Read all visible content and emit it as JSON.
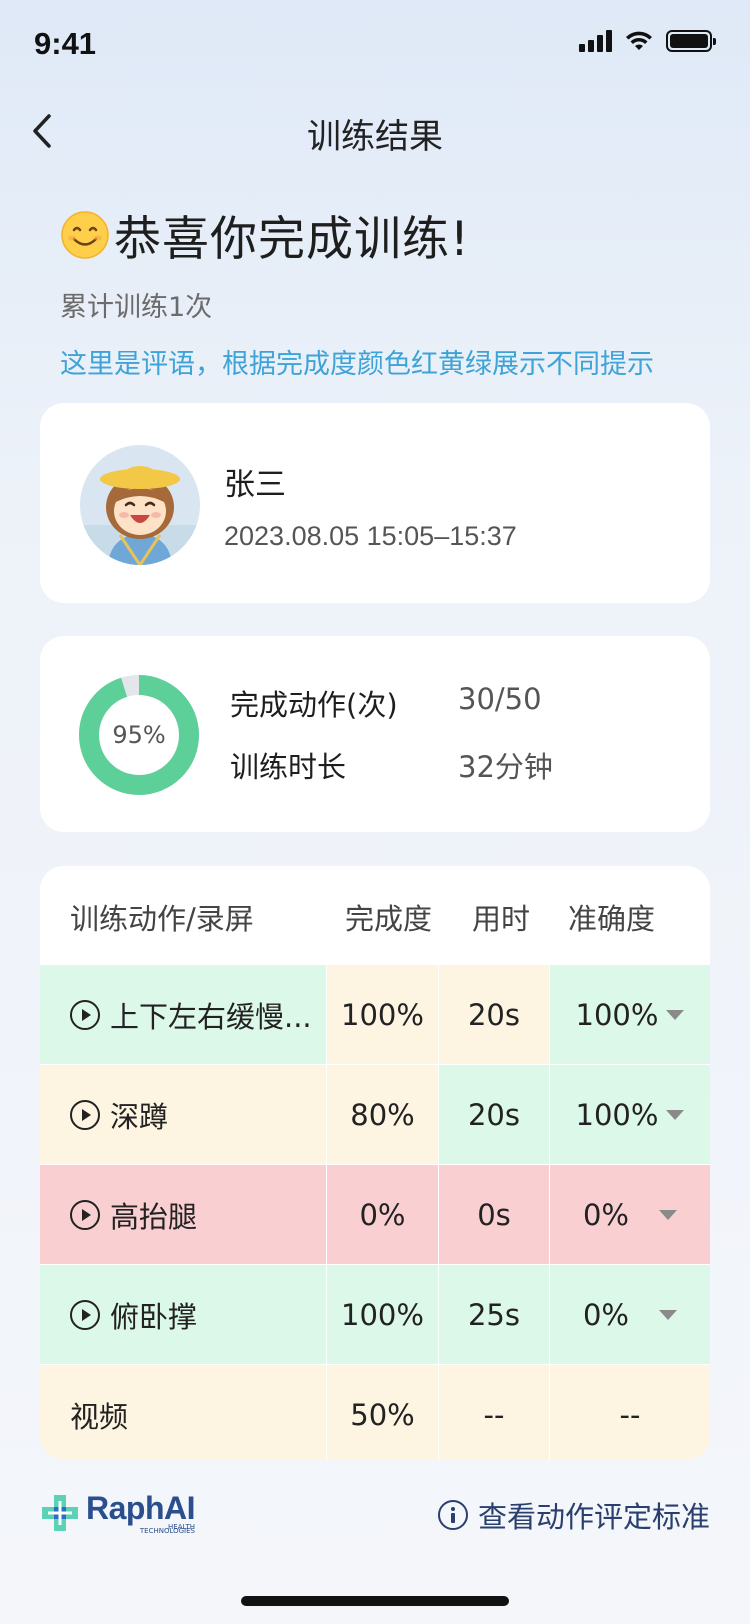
{
  "status_bar": {
    "time": "9:41"
  },
  "nav": {
    "title": "训练结果"
  },
  "header": {
    "congrats": "恭喜你完成训练!",
    "cumulative": "累计训练1次",
    "comment": "这里是评语，根据完成度颜色红黄绿展示不同提示"
  },
  "profile": {
    "name": "张三",
    "datetime": "2023.08.05 15:05–15:37"
  },
  "stats": {
    "completion_percent_label": "95%",
    "completion_fraction": 0.95,
    "actions_label": "完成动作(次)",
    "actions_value": "30/50",
    "duration_label": "训练时长",
    "duration_value": "32分钟"
  },
  "table": {
    "headers": [
      "训练动作/录屏",
      "完成度",
      "用时",
      "准确度"
    ],
    "rows": [
      {
        "name": "上下左右缓慢...",
        "completion": "100%",
        "time": "20s",
        "accuracy": "100%",
        "has_play": true,
        "has_caret": true
      },
      {
        "name": "深蹲",
        "completion": "80%",
        "time": "20s",
        "accuracy": "100%",
        "has_play": true,
        "has_caret": true
      },
      {
        "name": "高抬腿",
        "completion": "0%",
        "time": "0s",
        "accuracy": "0%",
        "has_play": true,
        "has_caret": true
      },
      {
        "name": "俯卧撑",
        "completion": "100%",
        "time": "25s",
        "accuracy": "0%",
        "has_play": true,
        "has_caret": true
      },
      {
        "name": "视频",
        "completion": "50%",
        "time": "--",
        "accuracy": "--",
        "has_play": false,
        "has_caret": false
      }
    ]
  },
  "footer": {
    "logo_text": "RaphAI",
    "logo_sub_1": "HEALTH",
    "logo_sub_2": "TECHNOLOGIES",
    "criteria_link": "查看动作评定标准"
  },
  "colors": {
    "green": "#dcf8e9",
    "yellow": "#fdf4e2",
    "red": "#f9cfd2",
    "donut_fill": "#5dcf98",
    "donut_track": "#e3e6ea",
    "comment_blue": "#3ea3d8"
  }
}
